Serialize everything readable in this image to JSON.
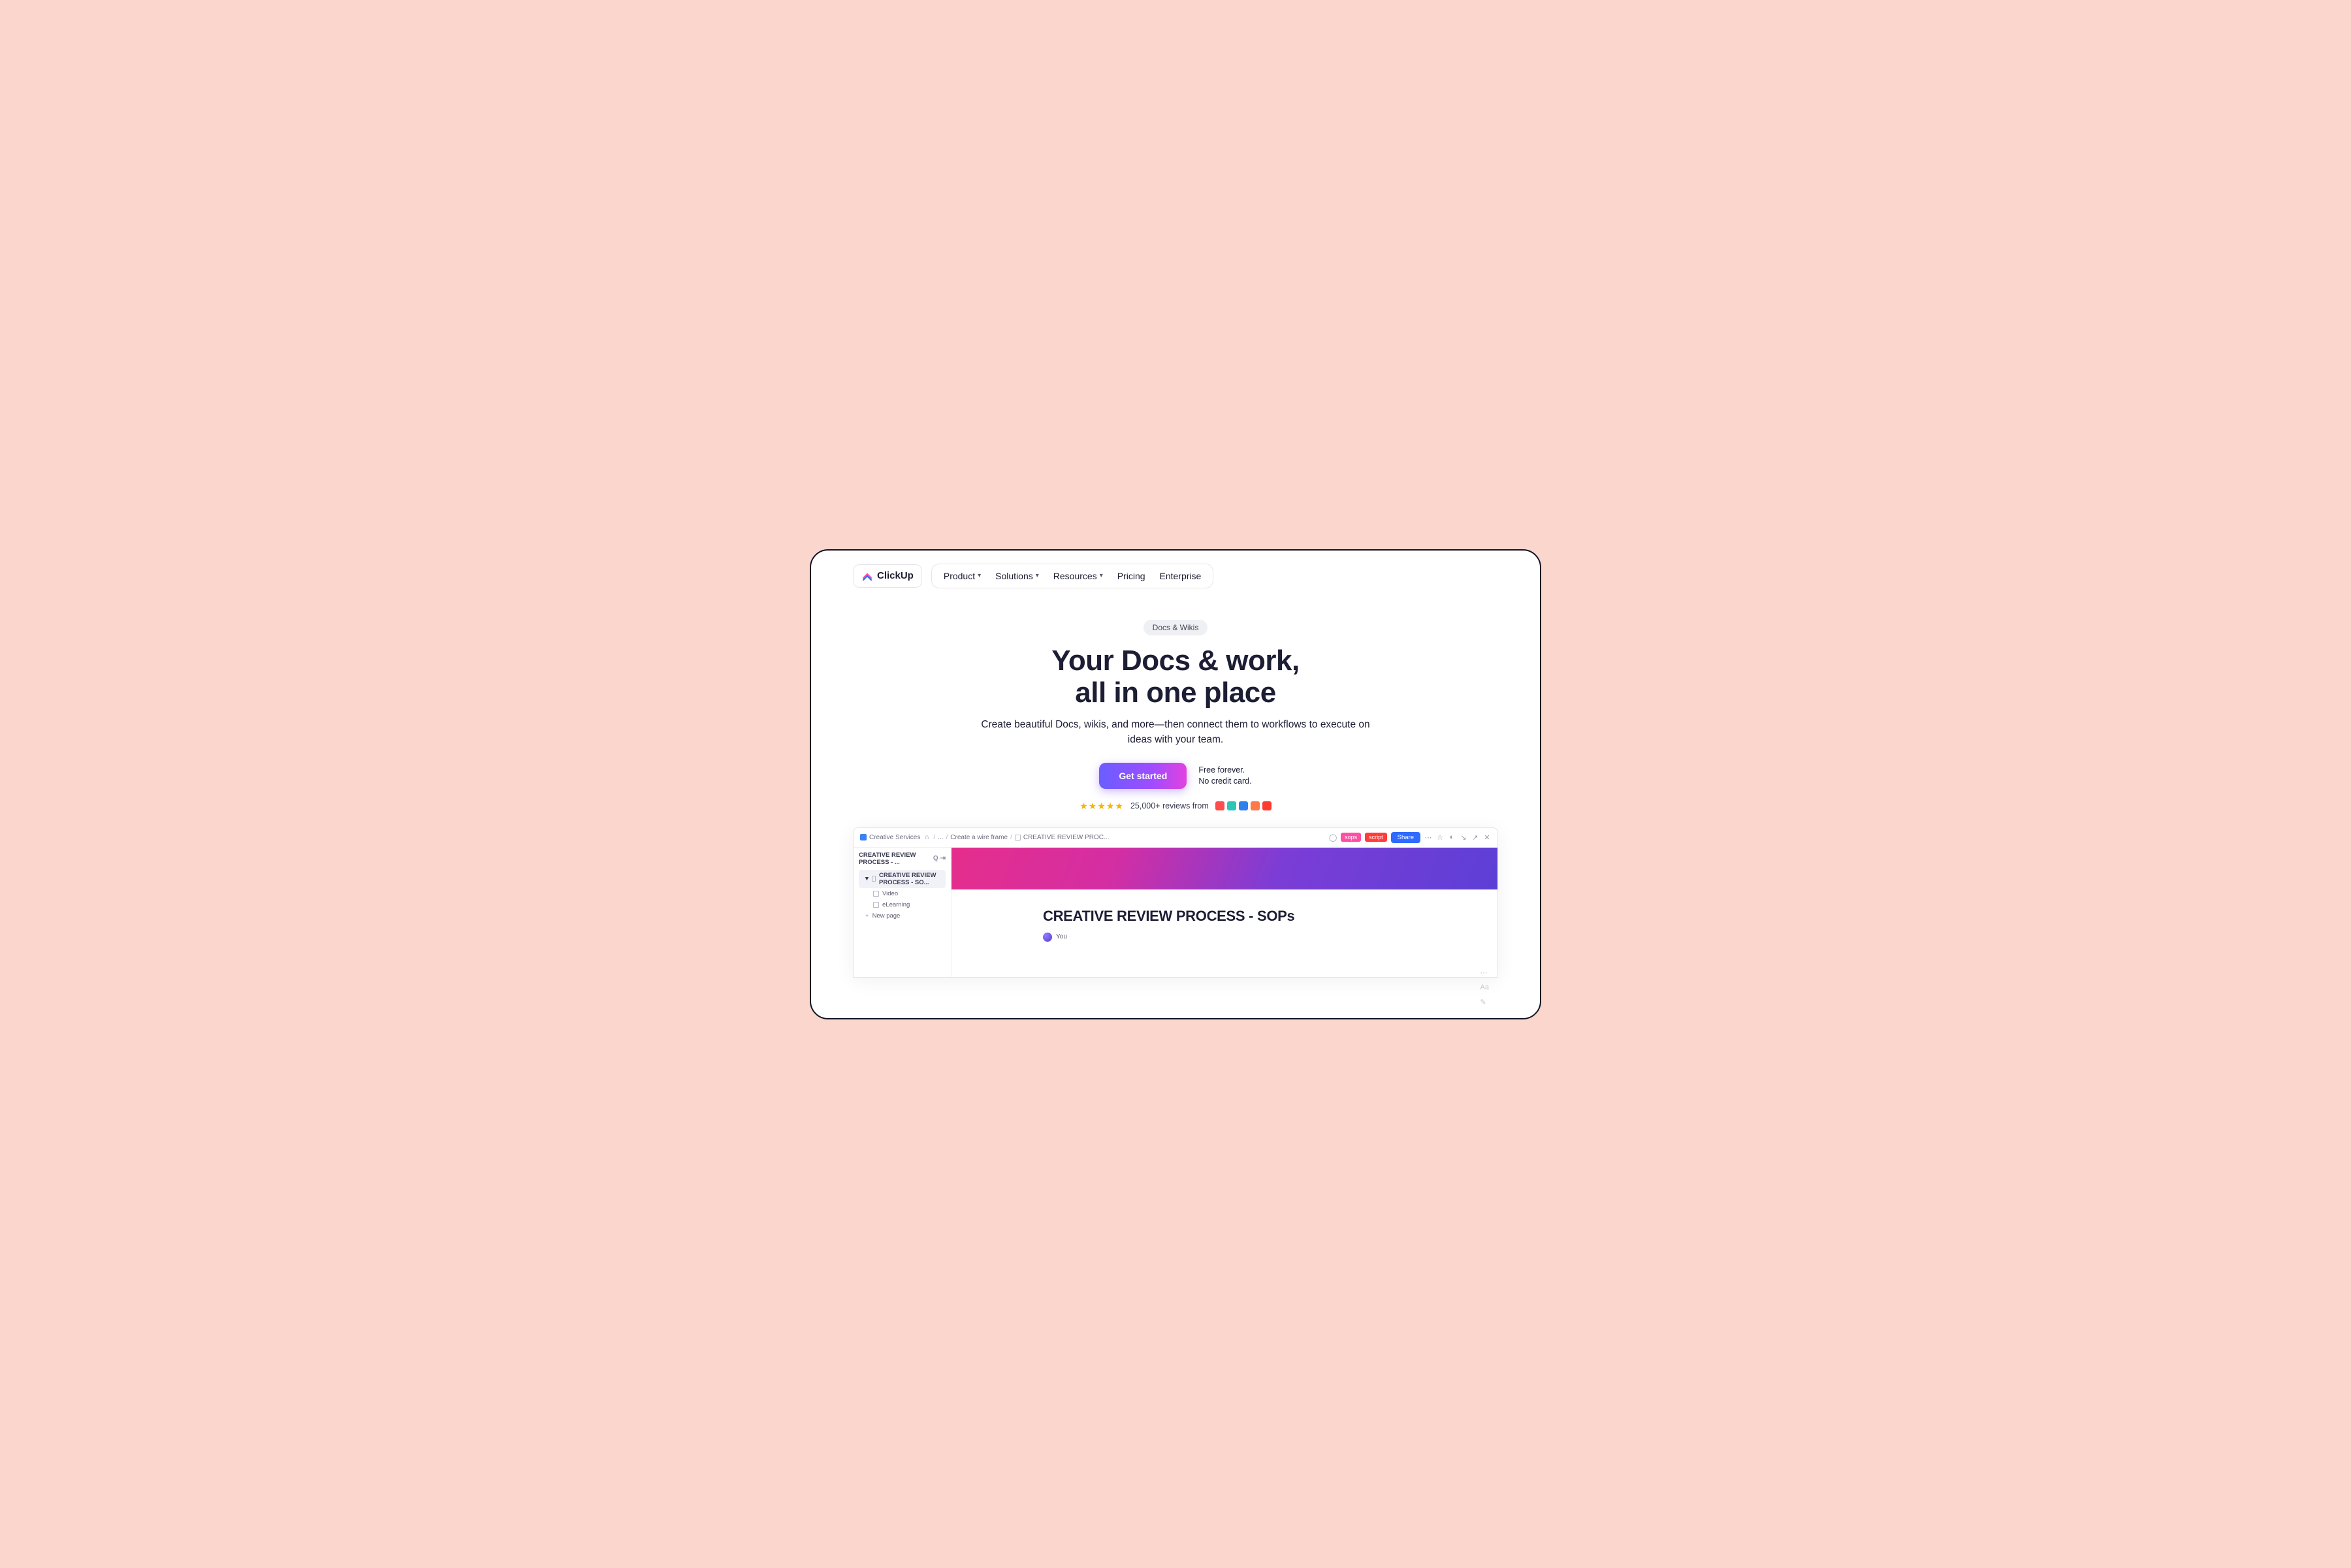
{
  "brand": "ClickUp",
  "nav": {
    "items": [
      {
        "label": "Product",
        "dropdown": true
      },
      {
        "label": "Solutions",
        "dropdown": true
      },
      {
        "label": "Resources",
        "dropdown": true
      },
      {
        "label": "Pricing",
        "dropdown": false
      },
      {
        "label": "Enterprise",
        "dropdown": false
      }
    ]
  },
  "hero": {
    "badge": "Docs & Wikis",
    "title_line1": "Your Docs & work,",
    "title_line2": "all in one place",
    "subtext": "Create beautiful Docs, wikis, and more—then connect them to workflows to execute on ideas with your team.",
    "cta_label": "Get started",
    "cta_side_line1": "Free forever.",
    "cta_side_line2": "No credit card.",
    "stars": "★★★★★",
    "reviews_text": "25,000+ reviews from"
  },
  "shot": {
    "breadcrumbs": {
      "root": "Creative Services",
      "mid1": "...",
      "mid2": "Create a wire frame",
      "tail": "CREATIVE REVIEW PROC..."
    },
    "tags": {
      "t1": "sops",
      "t2": "script"
    },
    "share": "Share",
    "side": {
      "title": "CREATIVE REVIEW PROCESS - ...",
      "items": [
        {
          "label": "CREATIVE REVIEW PROCESS - SO...",
          "active": true
        },
        {
          "label": "Video"
        },
        {
          "label": "eLearning"
        }
      ],
      "new": "New page"
    },
    "doc": {
      "title": "CREATIVE REVIEW PROCESS - SOPs",
      "author": "You"
    }
  }
}
